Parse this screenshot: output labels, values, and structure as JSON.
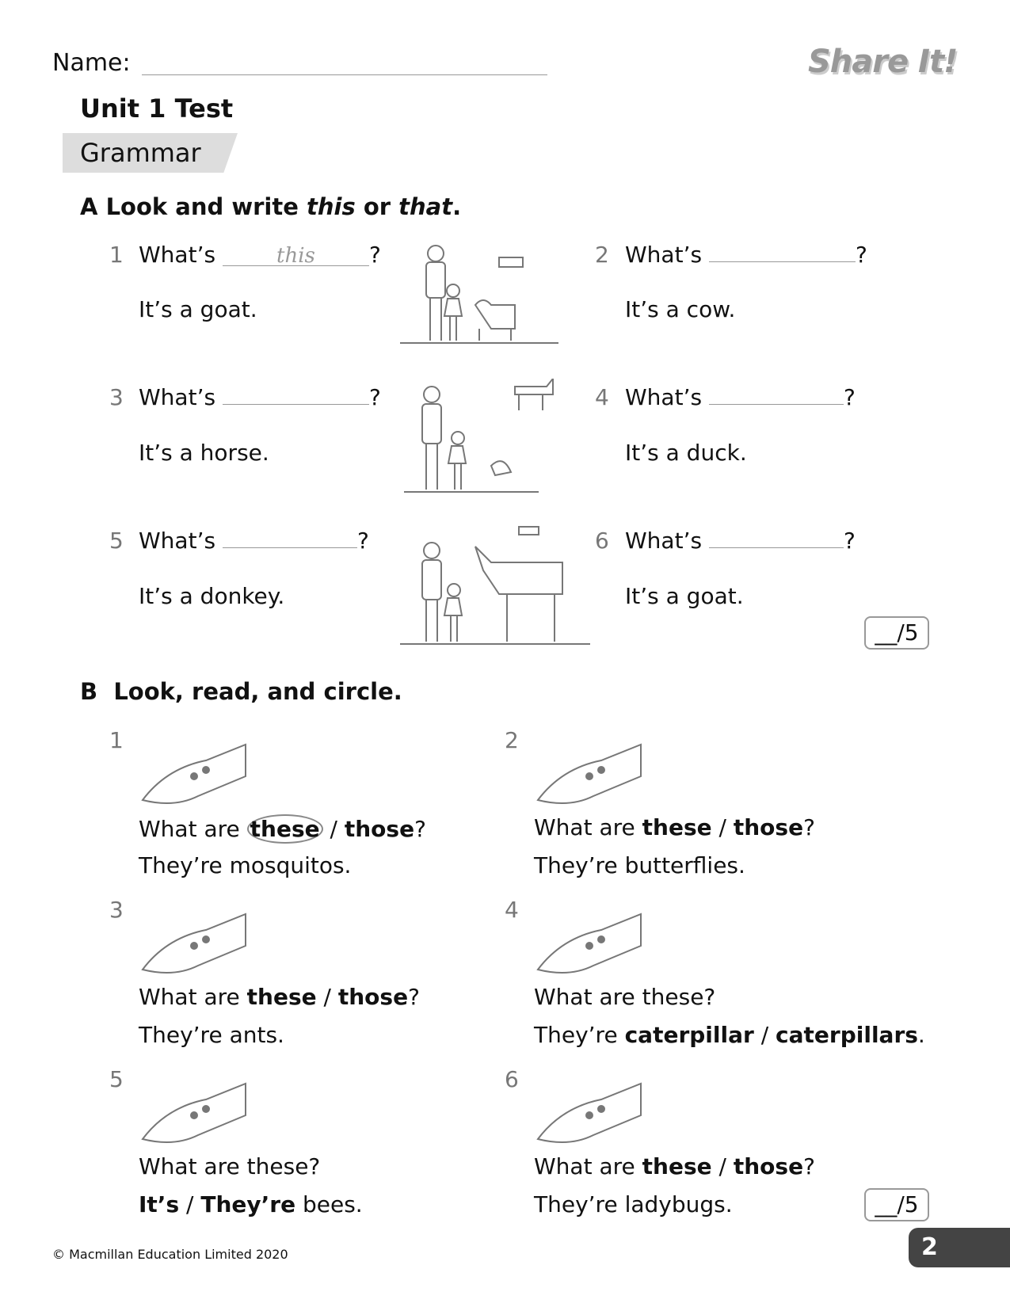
{
  "header": {
    "name_label": "Name:",
    "logo_text": "Share It!",
    "title": "Unit 1 Test",
    "section": "Grammar"
  },
  "part_a": {
    "letter": "A",
    "instruction_pre": "Look and write ",
    "word1": "this",
    "mid": " or ",
    "word2": "that",
    "end": ".",
    "items": [
      {
        "n": "1",
        "q": "What’s",
        "answer": "this",
        "a": "It’s a goat."
      },
      {
        "n": "2",
        "q": "What’s",
        "answer": "",
        "a": "It’s a cow."
      },
      {
        "n": "3",
        "q": "What’s",
        "answer": "",
        "a": "It’s a horse."
      },
      {
        "n": "4",
        "q": "What’s",
        "answer": "",
        "a": "It’s a duck."
      },
      {
        "n": "5",
        "q": "What’s",
        "answer": "",
        "a": "It’s a donkey."
      },
      {
        "n": "6",
        "q": "What’s",
        "answer": "",
        "a": "It’s a goat."
      }
    ],
    "score": "__/5"
  },
  "part_b": {
    "letter": "B",
    "instruction": "Look, read, and circle.",
    "items": [
      {
        "n": "1",
        "pre": "What are ",
        "opt1": "these",
        "sep": " / ",
        "opt2": "those",
        "post": "?",
        "line2": "They’re mosquitos."
      },
      {
        "n": "2",
        "pre": "What are ",
        "opt1": "these",
        "sep": " / ",
        "opt2": "those",
        "post": "?",
        "line2": "They’re butterflies."
      },
      {
        "n": "3",
        "pre": "What are ",
        "opt1": "these",
        "sep": " / ",
        "opt2": "those",
        "post": "?",
        "line2": "They’re ants."
      },
      {
        "n": "4",
        "line1": "What are these?",
        "pre": "They’re ",
        "opt1": "caterpillar",
        "sep": " / ",
        "opt2": "caterpillars",
        "post": "."
      },
      {
        "n": "5",
        "line1": "What are these?",
        "opt1": "It’s",
        "sep": " / ",
        "opt2": "They’re",
        "post": " bees."
      },
      {
        "n": "6",
        "pre": "What are ",
        "opt1": "these",
        "sep": " / ",
        "opt2": "those",
        "post": "?",
        "line2": "They’re ladybugs."
      }
    ],
    "score": "__/5"
  },
  "footer": {
    "copyright": "© Macmillan Education Limited 2020",
    "page": "2"
  }
}
